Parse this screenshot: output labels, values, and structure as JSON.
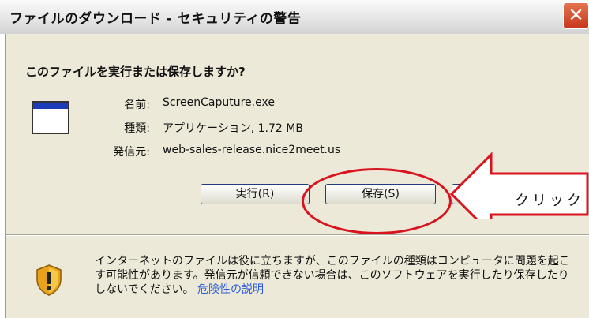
{
  "window": {
    "title": "ファイルのダウンロード - セキュリティの警告",
    "close_label": "✕"
  },
  "dialog": {
    "question": "このファイルを実行または保存しますか?",
    "file_icon": "application-window-icon",
    "fields": [
      {
        "label": "名前:",
        "value": "ScreenCaputure.exe"
      },
      {
        "label": "種類:",
        "value": "アプリケーション, 1.72 MB"
      },
      {
        "label": "発信元:",
        "value": "web-sales-release.nice2meet.us"
      }
    ],
    "buttons": {
      "run": "実行(R)",
      "save": "保存(S)"
    },
    "warning_icon": "shield-warning-icon",
    "warning_text": "インターネットのファイルは役に立ちますが、このファイルの種類はコンピュータに問題を起こす可能性があります。発信元が信頼できない場合は、このソフトウェアを実行したり保存したりしないでください。",
    "warning_link": "危険性の説明"
  },
  "annotation": {
    "callout_text": "クリック",
    "colors": {
      "ellipse": "#d8141e",
      "arrow": "#d8141e"
    }
  }
}
